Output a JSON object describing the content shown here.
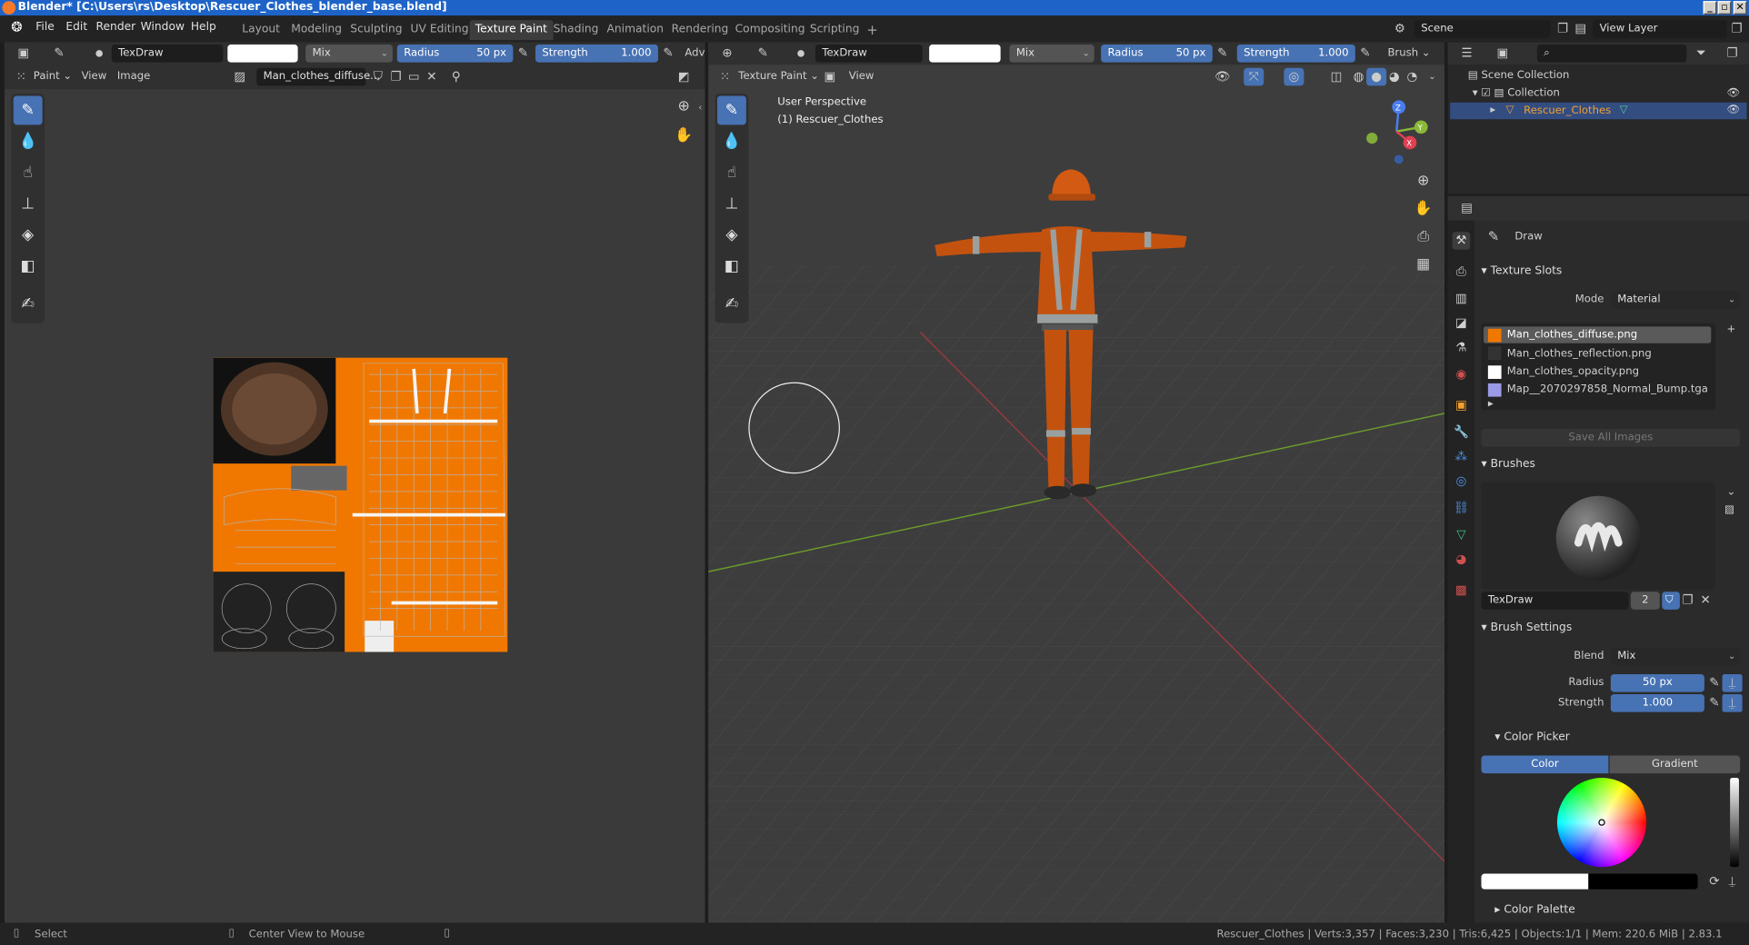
{
  "window": {
    "title": "Blender* [C:\\Users\\rs\\Desktop\\Rescuer_Clothes_blender_base.blend]",
    "min": "_",
    "max": "▫",
    "close": "✕"
  },
  "menu": [
    "File",
    "Edit",
    "Render",
    "Window",
    "Help"
  ],
  "workspaces": [
    "Layout",
    "Modeling",
    "Sculpting",
    "UV Editing",
    "Texture Paint",
    "Shading",
    "Animation",
    "Rendering",
    "Compositing",
    "Scripting"
  ],
  "active_workspace": "Texture Paint",
  "scene": {
    "name": "Scene",
    "view_layer": "View Layer"
  },
  "image_editor": {
    "brush": "TexDraw",
    "blend": "Mix",
    "radius_label": "Radius",
    "radius": "50 px",
    "strength_label": "Strength",
    "strength": "1.000",
    "advanced": "Adv",
    "menus": {
      "paint": "Paint",
      "view": "View",
      "image": "Image"
    },
    "image_name": "Man_clothes_diffuse..."
  },
  "viewport": {
    "brush": "TexDraw",
    "blend": "Mix",
    "radius_label": "Radius",
    "radius": "50 px",
    "strength_label": "Strength",
    "strength": "1.000",
    "brush_menu": "Brush",
    "mode": "Texture Paint",
    "view": "View",
    "overlay_line1": "User Perspective",
    "overlay_line2": "(1) Rescuer_Clothes",
    "gizmo": {
      "x": "X",
      "y": "Y",
      "z": "Z"
    }
  },
  "outliner": {
    "scene_collection": "Scene Collection",
    "collection": "Collection",
    "object": "Rescuer_Clothes"
  },
  "properties": {
    "tool_name": "Draw",
    "texture_slots": {
      "title": "Texture Slots",
      "mode_label": "Mode",
      "mode": "Material",
      "slots": [
        "Man_clothes_diffuse.png",
        "Man_clothes_reflection.png",
        "Man_clothes_opacity.png",
        "Map__2070297858_Normal_Bump.tga"
      ],
      "save_all": "Save All Images"
    },
    "brushes": {
      "title": "Brushes",
      "name": "TexDraw",
      "users": "2"
    },
    "brush_settings": {
      "title": "Brush Settings",
      "blend_label": "Blend",
      "blend": "Mix",
      "radius_label": "Radius",
      "radius": "50 px",
      "strength_label": "Strength",
      "strength": "1.000"
    },
    "color_picker": {
      "title": "Color Picker",
      "tab_color": "Color",
      "tab_gradient": "Gradient"
    },
    "color_palette": {
      "title": "Color Palette"
    }
  },
  "statusbar": {
    "select": "Select",
    "center": "Center View to Mouse",
    "info": "Rescuer_Clothes | Verts:3,357 | Faces:3,230 | Tris:6,425 | Objects:1/1 | Mem: 220.6 MiB | 2.83.1"
  },
  "colors": {
    "accent": "#4772b3",
    "orange": "#f07800",
    "titlebar": "#1e64c8"
  }
}
